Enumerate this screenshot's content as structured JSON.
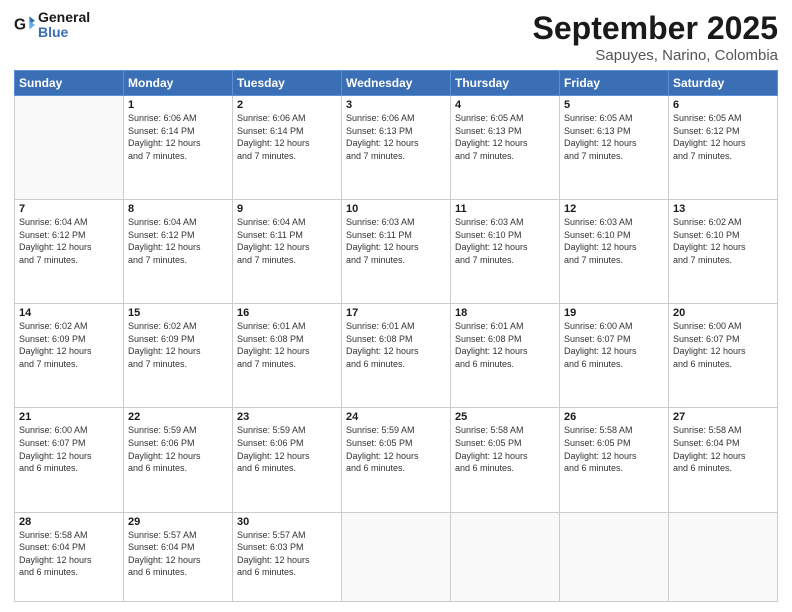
{
  "logo": {
    "text1": "General",
    "text2": "Blue"
  },
  "header": {
    "month": "September 2025",
    "location": "Sapuyes, Narino, Colombia"
  },
  "weekdays": [
    "Sunday",
    "Monday",
    "Tuesday",
    "Wednesday",
    "Thursday",
    "Friday",
    "Saturday"
  ],
  "weeks": [
    [
      {
        "day": "",
        "info": ""
      },
      {
        "day": "1",
        "info": "Sunrise: 6:06 AM\nSunset: 6:14 PM\nDaylight: 12 hours\nand 7 minutes."
      },
      {
        "day": "2",
        "info": "Sunrise: 6:06 AM\nSunset: 6:14 PM\nDaylight: 12 hours\nand 7 minutes."
      },
      {
        "day": "3",
        "info": "Sunrise: 6:06 AM\nSunset: 6:13 PM\nDaylight: 12 hours\nand 7 minutes."
      },
      {
        "day": "4",
        "info": "Sunrise: 6:05 AM\nSunset: 6:13 PM\nDaylight: 12 hours\nand 7 minutes."
      },
      {
        "day": "5",
        "info": "Sunrise: 6:05 AM\nSunset: 6:13 PM\nDaylight: 12 hours\nand 7 minutes."
      },
      {
        "day": "6",
        "info": "Sunrise: 6:05 AM\nSunset: 6:12 PM\nDaylight: 12 hours\nand 7 minutes."
      }
    ],
    [
      {
        "day": "7",
        "info": "Sunrise: 6:04 AM\nSunset: 6:12 PM\nDaylight: 12 hours\nand 7 minutes."
      },
      {
        "day": "8",
        "info": "Sunrise: 6:04 AM\nSunset: 6:12 PM\nDaylight: 12 hours\nand 7 minutes."
      },
      {
        "day": "9",
        "info": "Sunrise: 6:04 AM\nSunset: 6:11 PM\nDaylight: 12 hours\nand 7 minutes."
      },
      {
        "day": "10",
        "info": "Sunrise: 6:03 AM\nSunset: 6:11 PM\nDaylight: 12 hours\nand 7 minutes."
      },
      {
        "day": "11",
        "info": "Sunrise: 6:03 AM\nSunset: 6:10 PM\nDaylight: 12 hours\nand 7 minutes."
      },
      {
        "day": "12",
        "info": "Sunrise: 6:03 AM\nSunset: 6:10 PM\nDaylight: 12 hours\nand 7 minutes."
      },
      {
        "day": "13",
        "info": "Sunrise: 6:02 AM\nSunset: 6:10 PM\nDaylight: 12 hours\nand 7 minutes."
      }
    ],
    [
      {
        "day": "14",
        "info": "Sunrise: 6:02 AM\nSunset: 6:09 PM\nDaylight: 12 hours\nand 7 minutes."
      },
      {
        "day": "15",
        "info": "Sunrise: 6:02 AM\nSunset: 6:09 PM\nDaylight: 12 hours\nand 7 minutes."
      },
      {
        "day": "16",
        "info": "Sunrise: 6:01 AM\nSunset: 6:08 PM\nDaylight: 12 hours\nand 7 minutes."
      },
      {
        "day": "17",
        "info": "Sunrise: 6:01 AM\nSunset: 6:08 PM\nDaylight: 12 hours\nand 6 minutes."
      },
      {
        "day": "18",
        "info": "Sunrise: 6:01 AM\nSunset: 6:08 PM\nDaylight: 12 hours\nand 6 minutes."
      },
      {
        "day": "19",
        "info": "Sunrise: 6:00 AM\nSunset: 6:07 PM\nDaylight: 12 hours\nand 6 minutes."
      },
      {
        "day": "20",
        "info": "Sunrise: 6:00 AM\nSunset: 6:07 PM\nDaylight: 12 hours\nand 6 minutes."
      }
    ],
    [
      {
        "day": "21",
        "info": "Sunrise: 6:00 AM\nSunset: 6:07 PM\nDaylight: 12 hours\nand 6 minutes."
      },
      {
        "day": "22",
        "info": "Sunrise: 5:59 AM\nSunset: 6:06 PM\nDaylight: 12 hours\nand 6 minutes."
      },
      {
        "day": "23",
        "info": "Sunrise: 5:59 AM\nSunset: 6:06 PM\nDaylight: 12 hours\nand 6 minutes."
      },
      {
        "day": "24",
        "info": "Sunrise: 5:59 AM\nSunset: 6:05 PM\nDaylight: 12 hours\nand 6 minutes."
      },
      {
        "day": "25",
        "info": "Sunrise: 5:58 AM\nSunset: 6:05 PM\nDaylight: 12 hours\nand 6 minutes."
      },
      {
        "day": "26",
        "info": "Sunrise: 5:58 AM\nSunset: 6:05 PM\nDaylight: 12 hours\nand 6 minutes."
      },
      {
        "day": "27",
        "info": "Sunrise: 5:58 AM\nSunset: 6:04 PM\nDaylight: 12 hours\nand 6 minutes."
      }
    ],
    [
      {
        "day": "28",
        "info": "Sunrise: 5:58 AM\nSunset: 6:04 PM\nDaylight: 12 hours\nand 6 minutes."
      },
      {
        "day": "29",
        "info": "Sunrise: 5:57 AM\nSunset: 6:04 PM\nDaylight: 12 hours\nand 6 minutes."
      },
      {
        "day": "30",
        "info": "Sunrise: 5:57 AM\nSunset: 6:03 PM\nDaylight: 12 hours\nand 6 minutes."
      },
      {
        "day": "",
        "info": ""
      },
      {
        "day": "",
        "info": ""
      },
      {
        "day": "",
        "info": ""
      },
      {
        "day": "",
        "info": ""
      }
    ]
  ]
}
